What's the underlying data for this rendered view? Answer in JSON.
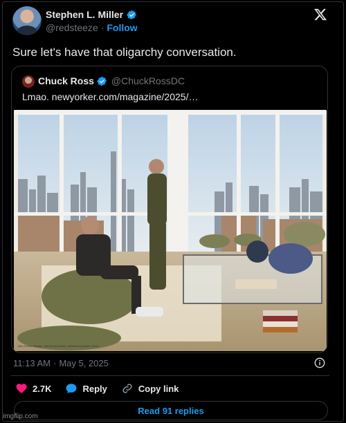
{
  "author": {
    "name": "Stephen L. Miller",
    "handle": "@redsteeze",
    "separator": "·",
    "follow_label": "Follow"
  },
  "tweet": {
    "text": "Sure let's have that oligarchy conversation."
  },
  "quoted_tweet": {
    "name": "Chuck Ross",
    "handle": "@ChuckRossDC",
    "text": "Lmao. newyorker.com/magazine/2025/…",
    "photo_caption": "Alex Soros, investor, and Huma Abedin, political consultant, NoHo."
  },
  "meta": {
    "time": "11:13 AM",
    "separator": "·",
    "date": "May 5, 2025"
  },
  "actions": {
    "like_count": "2.7K",
    "reply_label": "Reply",
    "copy_link_label": "Copy link"
  },
  "read_replies_label": "Read 91 replies",
  "watermark": "imgflip.com",
  "colors": {
    "accent": "#1d9bf0",
    "like": "#f91880",
    "background": "#000000",
    "muted": "#71767b",
    "border": "#2f3336"
  },
  "icons": {
    "verified": "verified-badge-icon",
    "x_logo": "x-logo-icon",
    "info": "info-icon",
    "heart": "heart-icon",
    "reply": "reply-bubble-icon",
    "link": "link-icon"
  }
}
